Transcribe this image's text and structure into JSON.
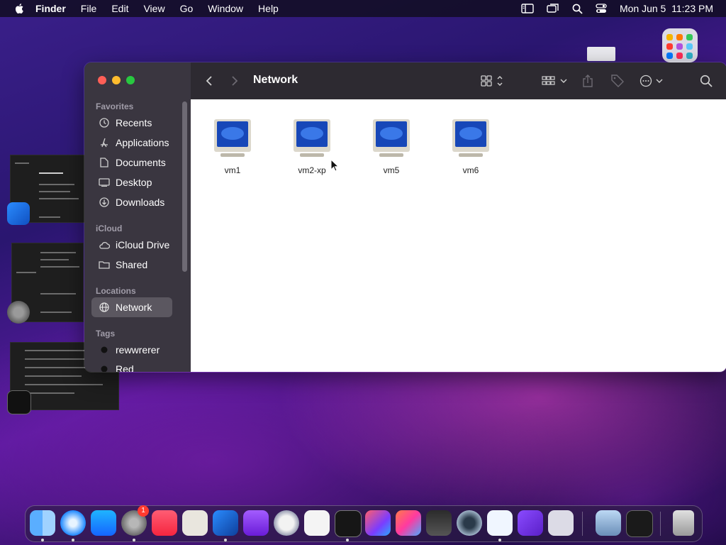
{
  "menubar": {
    "app": "Finder",
    "items": [
      "File",
      "Edit",
      "View",
      "Go",
      "Window",
      "Help"
    ],
    "clock": "Mon Jun 5  11:23 PM"
  },
  "finder": {
    "title": "Network",
    "sidebar": {
      "favorites_header": "Favorites",
      "favorites": [
        "Recents",
        "Applications",
        "Documents",
        "Desktop",
        "Downloads"
      ],
      "icloud_header": "iCloud",
      "icloud": [
        "iCloud Drive",
        "Shared"
      ],
      "locations_header": "Locations",
      "locations": [
        "Network"
      ],
      "tags_header": "Tags",
      "tags": [
        "rewwrerer",
        "Red"
      ]
    },
    "items": [
      "vm1",
      "vm2-xp",
      "vm5",
      "vm6"
    ]
  },
  "dock": {
    "badge_count": "1",
    "apps": [
      "finder",
      "safari",
      "app-store",
      "system-settings",
      "music",
      "script-editor",
      "mail-bird",
      "podcasts-stack",
      "bbedit",
      "textedit",
      "terminal",
      "shortcuts",
      "photo-app",
      "garageband",
      "quicktime",
      "vscode",
      "visual-studio",
      "launchpad",
      "preview",
      "keyboard-shortcuts",
      "trash"
    ]
  },
  "colors": {
    "accent_selected": "#5b5760",
    "sidebar_bg": "#3a3640",
    "toolbar_bg": "#2d2a31"
  }
}
